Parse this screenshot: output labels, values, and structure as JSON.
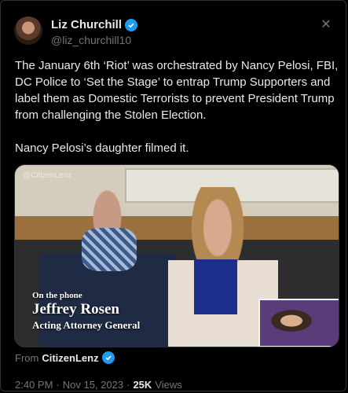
{
  "author": {
    "display_name": "Liz Churchill",
    "handle": "@liz_churchill10"
  },
  "tweet": {
    "text": "The January 6th ‘Riot’ was orchestrated by Nancy Pelosi, FBI, DC Police to ‘Set the Stage’ to entrap Trump Supporters and label them as Domestic Terrorists to prevent President Trump from challenging the Stolen Election.\n\nNancy Pelosi’s daughter filmed it."
  },
  "media": {
    "watermark": "@CitizenLenz",
    "caption_line1": "On the phone",
    "caption_line2": "Jeffrey Rosen",
    "caption_line3": "Acting Attorney General"
  },
  "source": {
    "from_label": "From",
    "from_name": "CitizenLenz"
  },
  "meta": {
    "time": "2:40 PM",
    "separator1": "·",
    "date": "Nov 15, 2023",
    "separator2": "·",
    "views_count": "25K",
    "views_label": "Views"
  },
  "colors": {
    "background": "#000000",
    "verified": "#1d9bf0",
    "text_primary": "#e7e9ea",
    "text_secondary": "#71767b"
  },
  "icons": {
    "verified": "verified-badge-icon",
    "close": "close-icon"
  }
}
